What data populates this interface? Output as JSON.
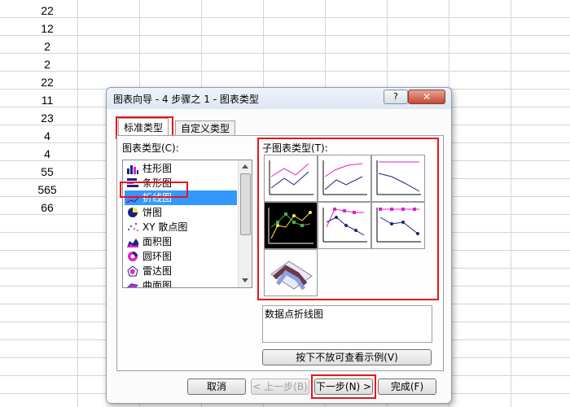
{
  "sheet": {
    "values": [
      "22",
      "12",
      "2",
      "2",
      "22",
      "11",
      "23",
      "4",
      "4",
      "55",
      "565",
      "66"
    ]
  },
  "dialog": {
    "title": "图表向导 - 4 步骤之 1 - 图表类型",
    "help_label": "?",
    "close_label": "✕",
    "tabs": [
      "标准类型",
      "自定义类型"
    ],
    "chart_type_label": "图表类型(C):",
    "chart_types": [
      {
        "label": "柱形图",
        "icon": "column-chart-icon"
      },
      {
        "label": "条形图",
        "icon": "bar-chart-icon"
      },
      {
        "label": "折线图",
        "icon": "line-chart-icon"
      },
      {
        "label": "饼图",
        "icon": "pie-chart-icon"
      },
      {
        "label": "XY 散点图",
        "icon": "scatter-chart-icon"
      },
      {
        "label": "面积图",
        "icon": "area-chart-icon"
      },
      {
        "label": "圆环图",
        "icon": "doughnut-chart-icon"
      },
      {
        "label": "雷达图",
        "icon": "radar-chart-icon"
      },
      {
        "label": "曲面图",
        "icon": "surface-chart-icon"
      }
    ],
    "selected_chart_type": "折线图",
    "subtype_label": "子图表类型(T):",
    "subtype_description": "数据点折线图",
    "preview_button": "按下不放可查看示例(V)",
    "buttons": {
      "cancel": "取消",
      "back": "< 上一步(B)",
      "next": "下一步(N) >",
      "finish": "完成(F)"
    },
    "colors": {
      "highlight": "#e8141c",
      "selection": "#3399ff",
      "series_magenta": "#e020d0",
      "series_navy": "#1a237e"
    }
  }
}
